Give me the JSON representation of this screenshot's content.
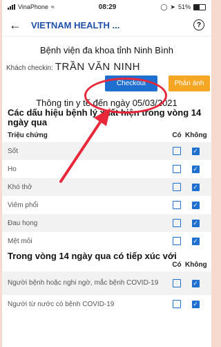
{
  "status_bar": {
    "carrier": "VinaPhone",
    "time": "08:29",
    "battery": "51%"
  },
  "app_bar": {
    "back_icon": "arrow-left-icon",
    "title": "VIETNAM HEALTH ...",
    "help_icon": "question-circle-icon"
  },
  "hospital_name": "Bệnh viện đa khoa tỉnh Ninh Bình",
  "guest": {
    "label": "Khách checkin:",
    "name": "TRẦN VĂN NINH"
  },
  "actions": {
    "checkout_label": "Checkout",
    "report_label": "Phản ánh"
  },
  "health_info_title": "Thông tin y tế đến ngày 05/03/2021",
  "symptoms_section": {
    "title": "Các dấu hiệu bệnh lý xuất hiện trong vòng 14 ngày qua",
    "col_label": "Triệu chứng",
    "yes_label": "Có",
    "no_label": "Không",
    "items": [
      "Sốt",
      "Ho",
      "Khó thở",
      "Viêm phổi",
      "Đau họng",
      "Mệt mỏi"
    ]
  },
  "contact_section": {
    "title": "Trong vòng 14 ngày qua có tiếp xúc với",
    "yes_label": "Có",
    "no_label": "Không",
    "items": [
      "Người bệnh hoặc nghi ngờ, mắc bệnh COVID-19",
      "Người từ nước có bệnh COVID-19"
    ]
  },
  "colors": {
    "accent": "#1e6fd0",
    "report": "#f5a623",
    "highlight": "#e8283a",
    "title": "#1f4fa8"
  }
}
